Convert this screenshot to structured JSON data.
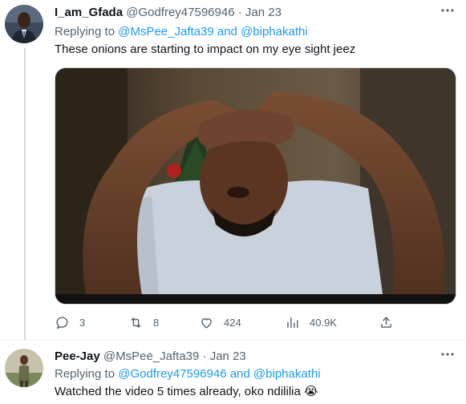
{
  "tweets": [
    {
      "name": "I_am_Gfada",
      "handle": "@Godfrey47596946",
      "separator": "·",
      "date": "Jan 23",
      "replying_prefix": "Replying to",
      "mention_1": "@MsPee_Jafta39",
      "and": "and",
      "mention_2": "@biphakathi",
      "text": "These onions are starting to impact on my eye sight jeez",
      "stats": {
        "replies": "3",
        "retweets": "8",
        "likes": "424",
        "views": "40.9K"
      }
    },
    {
      "name": "Pee-Jay",
      "handle": "@MsPee_Jafta39",
      "separator": "·",
      "date": "Jan 23",
      "replying_prefix": "Replying to",
      "mention_1": "@Godfrey47596946",
      "and": "and",
      "mention_2": "@biphakathi",
      "text": "Watched the video 5 times already, oko ndililia 😭"
    }
  ],
  "icons": {
    "more": "more-icon",
    "reply": "reply-icon",
    "retweet": "retweet-icon",
    "like": "like-icon",
    "views": "views-icon",
    "share": "share-icon"
  },
  "colors": {
    "link": "#1d9bf0",
    "secondary": "#536471",
    "text": "#0f1419"
  }
}
